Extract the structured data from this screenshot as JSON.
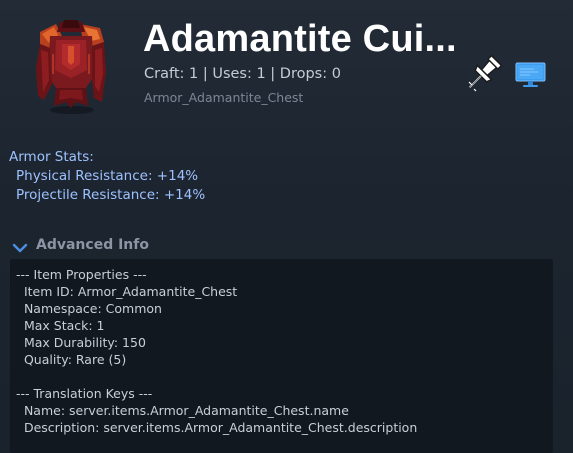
{
  "item": {
    "title": "Adamantite Cui...",
    "stats_line": "Craft: 1 | Uses: 1 | Drops: 0",
    "internal_id": "Armor_Adamantite_Chest",
    "icon": "adamantite-chestplate-icon"
  },
  "actions": {
    "pin_icon": "pin-icon",
    "monitor_icon": "monitor-icon"
  },
  "armor": {
    "title": "Armor Stats:",
    "lines": [
      "Physical Resistance: +14%",
      "Projectile Resistance: +14%"
    ]
  },
  "advanced": {
    "label": "Advanced Info",
    "chevron_icon": "chevron-down-icon",
    "lines": [
      "--- Item Properties ---",
      "  Item ID: Armor_Adamantite_Chest",
      "  Namespace: Common",
      "  Max Stack: 1",
      "  Max Durability: 150",
      "  Quality: Rare (5)",
      "",
      "--- Translation Keys ---",
      "  Name: server.items.Armor_Adamantite_Chest.name",
      "  Description: server.items.Armor_Adamantite_Chest.description"
    ]
  },
  "colors": {
    "background": "#1e2631",
    "title": "#ffffff",
    "stat_text": "#9ec2ff",
    "advanced_label": "#8b95a3",
    "advanced_box": "#121820",
    "chevron": "#4d8fe0",
    "monitor": "#3d9cf0"
  }
}
